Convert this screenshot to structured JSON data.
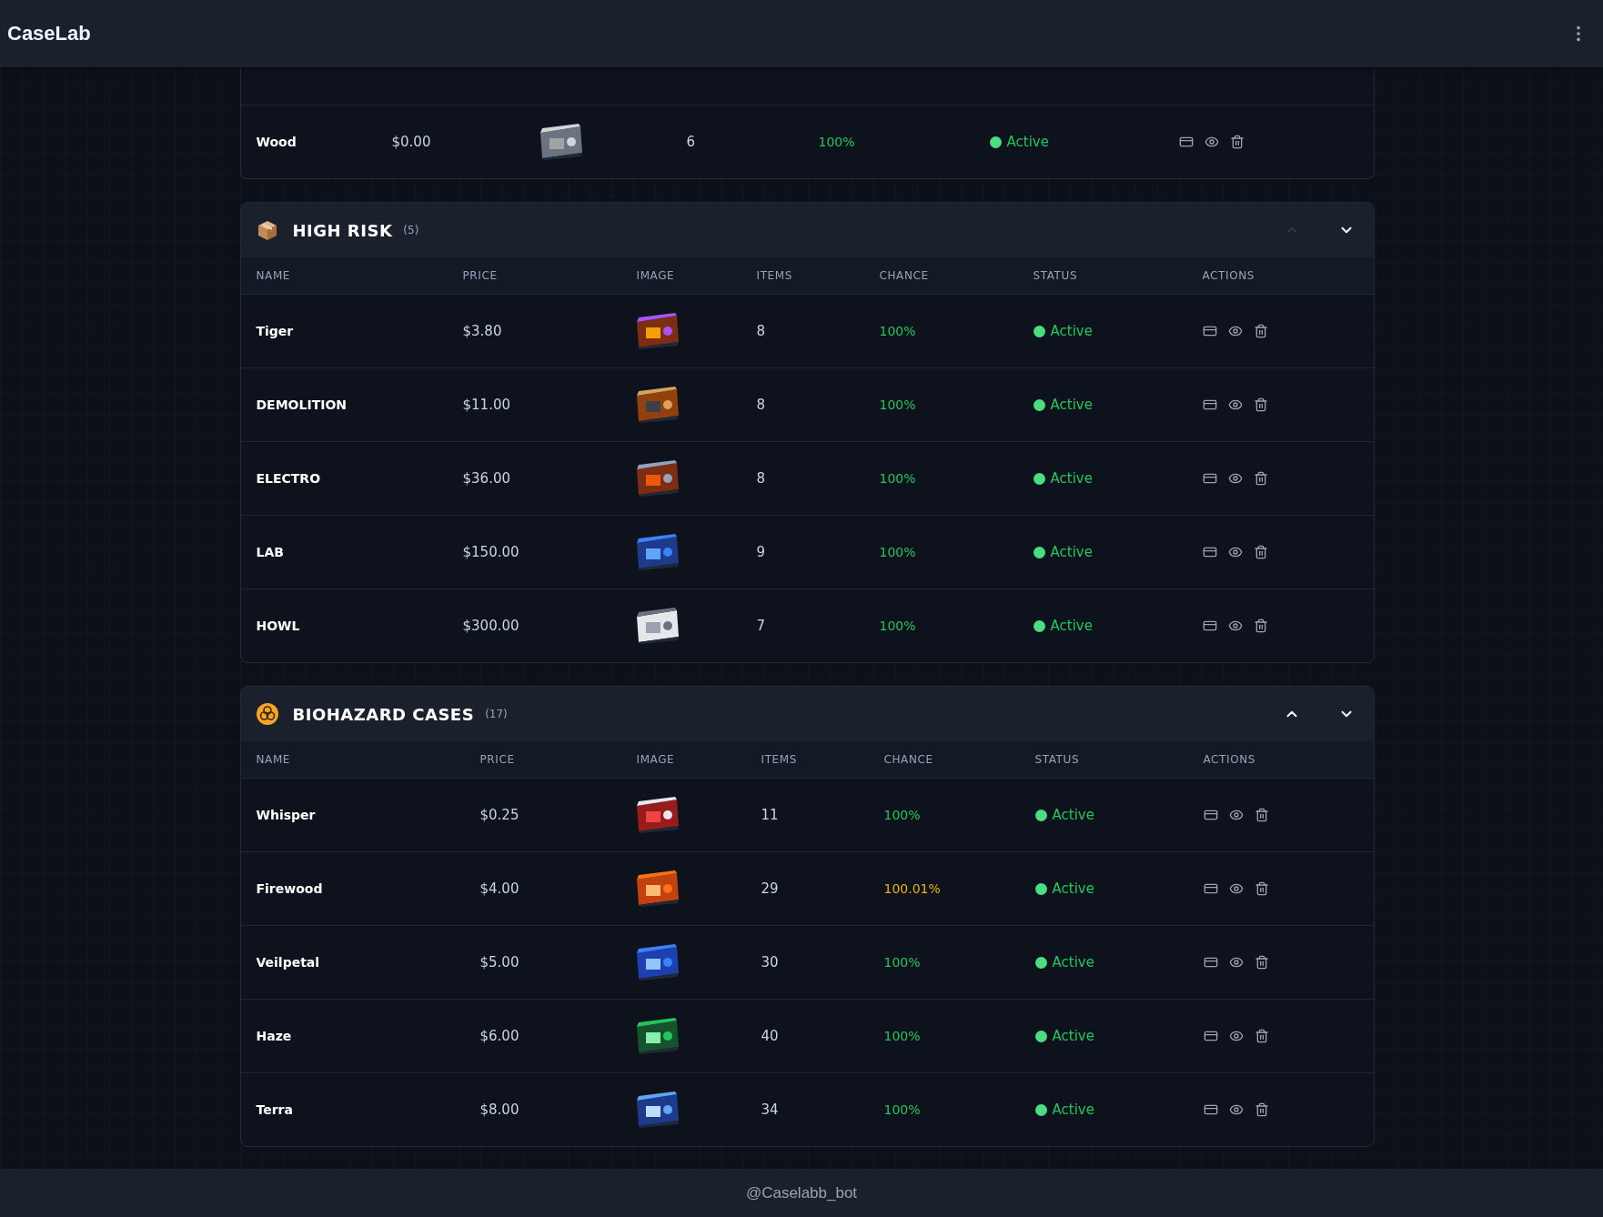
{
  "app": {
    "title": "CaseLab"
  },
  "sections": [
    {
      "kind": "partial",
      "rows": [
        {
          "name": "Wood",
          "price": "$0.00",
          "items": "6",
          "chance": "100%",
          "chance_over": false,
          "status": "Active",
          "active": true
        }
      ]
    },
    {
      "kind": "box",
      "title": "HIGH RISK",
      "count": "(5)",
      "up_disabled": true,
      "columns": [
        "NAME",
        "PRICE",
        "IMAGE",
        "ITEMS",
        "CHANCE",
        "STATUS",
        "ACTIONS"
      ],
      "rows": [
        {
          "name": "Tiger",
          "price": "$3.80",
          "items": "8",
          "chance": "100%",
          "chance_over": false,
          "status": "Active",
          "active": true
        },
        {
          "name": "DEMOLITION",
          "price": "$11.00",
          "items": "8",
          "chance": "100%",
          "chance_over": false,
          "status": "Active",
          "active": true
        },
        {
          "name": "ELECTRO",
          "price": "$36.00",
          "items": "8",
          "chance": "100%",
          "chance_over": false,
          "status": "Active",
          "active": true
        },
        {
          "name": "LAB",
          "price": "$150.00",
          "items": "9",
          "chance": "100%",
          "chance_over": false,
          "status": "Active",
          "active": true
        },
        {
          "name": "HOWL",
          "price": "$300.00",
          "items": "7",
          "chance": "100%",
          "chance_over": false,
          "status": "Active",
          "active": true
        }
      ]
    },
    {
      "kind": "biohazard",
      "title": "BIOHAZARD CASES",
      "count": "(17)",
      "up_disabled": false,
      "columns": [
        "NAME",
        "PRICE",
        "IMAGE",
        "ITEMS",
        "CHANCE",
        "STATUS",
        "ACTIONS"
      ],
      "rows": [
        {
          "name": "Whisper",
          "price": "$0.25",
          "items": "11",
          "chance": "100%",
          "chance_over": false,
          "status": "Active",
          "active": true
        },
        {
          "name": "Firewood",
          "price": "$4.00",
          "items": "29",
          "chance": "100.01%",
          "chance_over": true,
          "status": "Active",
          "active": true
        },
        {
          "name": "Veilpetal",
          "price": "$5.00",
          "items": "30",
          "chance": "100%",
          "chance_over": false,
          "status": "Active",
          "active": true
        },
        {
          "name": "Haze",
          "price": "$6.00",
          "items": "40",
          "chance": "100%",
          "chance_over": false,
          "status": "Active",
          "active": true
        },
        {
          "name": "Terra",
          "price": "$8.00",
          "items": "34",
          "chance": "100%",
          "chance_over": false,
          "status": "Active",
          "active": true
        }
      ]
    }
  ],
  "footer": {
    "text": "@Caselabb_bot"
  }
}
